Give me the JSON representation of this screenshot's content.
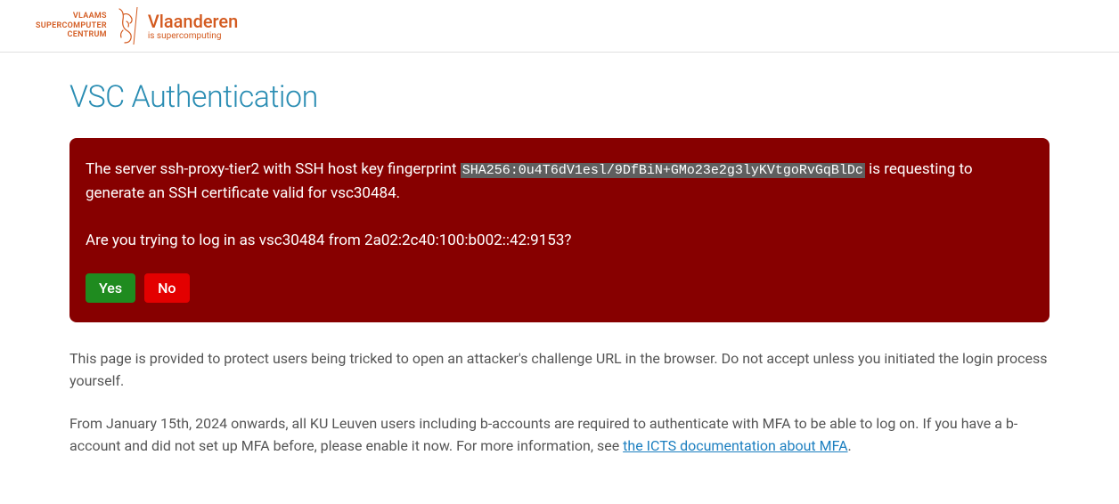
{
  "header": {
    "logo_line1": "VLAAMS",
    "logo_line2": "SUPERCOMPUTER",
    "logo_line3": "CENTRUM",
    "brand_main": "Vlaanderen",
    "brand_sub": "is supercomputing",
    "accent_color": "#d35a1f"
  },
  "page": {
    "title": "VSC Authentication"
  },
  "alert": {
    "prefix": "The server ssh-proxy-tier2 with SSH host key fingerprint ",
    "fingerprint": "SHA256:0u4T6dV1esl/9DfBiN+GMo23e2g3lyKVtgoRvGqBlDc",
    "suffix": " is requesting to generate an SSH certificate valid for vsc30484.",
    "question": "Are you trying to log in as vsc30484 from 2a02:2c40:100:b002::42:9153?",
    "yes_label": "Yes",
    "no_label": "No",
    "bg_color": "#870000"
  },
  "info": {
    "paragraph1": "This page is provided to protect users being tricked to open an attacker's challenge URL in the browser. Do not accept unless you initiated the login process yourself.",
    "paragraph2_pre": "From January 15th, 2024 onwards, all KU Leuven users including b-accounts are required to authenticate with MFA to be able to log on. If you have a b-account and did not set up MFA before, please enable it now. For more information, see ",
    "link_text": "the ICTS documentation about MFA",
    "paragraph2_post": "."
  }
}
